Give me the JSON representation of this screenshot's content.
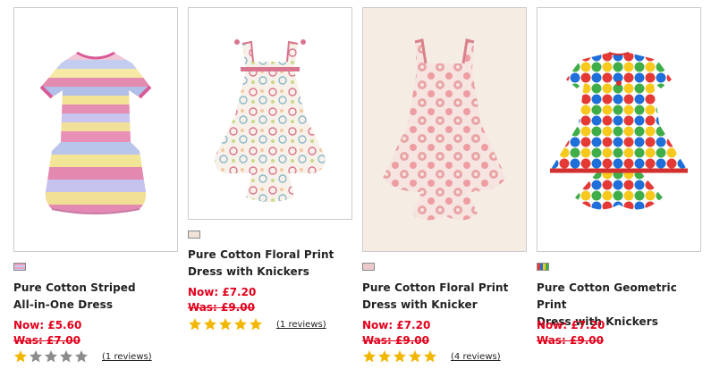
{
  "colors": {
    "price": "#e3001b",
    "star_on": "#f2b705",
    "star_off": "#8c8c8c"
  },
  "products": [
    {
      "name_line1": "Pure Cotton Striped",
      "name_line2": "All-in-One Dress",
      "now": "Now: £5.60",
      "was": "Was: £7.00",
      "rating": 1,
      "reviews": "(1 reviews)",
      "image": "striped-dress-image",
      "swatch": "pink-stripe-swatch"
    },
    {
      "name_line1": "Pure Cotton Floral Print",
      "name_line2": "Dress with Knickers",
      "now": "Now: £7.20",
      "was": "Was: £9.00",
      "rating": 5,
      "reviews": "(1 reviews)",
      "image": "floral-dress-image",
      "swatch": "floral-swatch"
    },
    {
      "name_line1": "Pure Cotton Floral Print",
      "name_line2": "Dress with Knicker",
      "now": "Now: £7.20",
      "was": "Was: £9.00",
      "rating": 5,
      "reviews": "(4 reviews)",
      "image": "pink-floral-dress-image",
      "swatch": "pink-floral-swatch"
    },
    {
      "name_line1": "Pure Cotton Geometric Print",
      "name_line2": "Dress with Knickers",
      "now": "Now: £7.20",
      "was": "Was: £9.00",
      "rating": null,
      "reviews": null,
      "image": "geometric-dress-image",
      "swatch": "multicolour-swatch"
    }
  ]
}
